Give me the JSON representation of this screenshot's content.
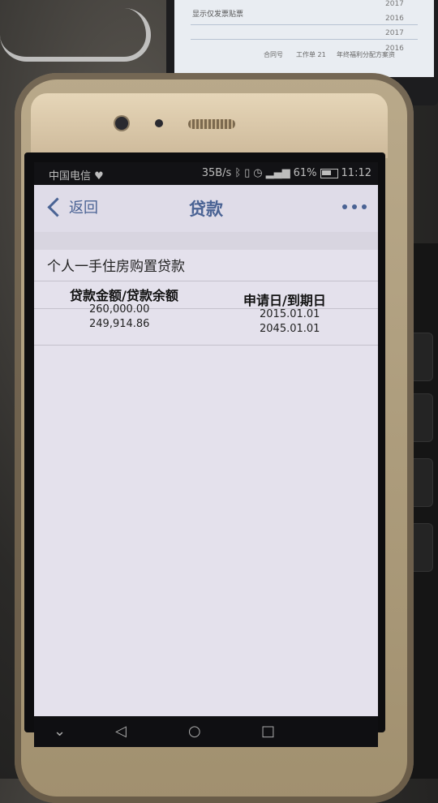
{
  "status": {
    "carrier": "中国电信",
    "net_speed": "35B/s",
    "battery": "61%",
    "time": "11:12"
  },
  "nav": {
    "back_label": "返回",
    "title": "贷款"
  },
  "loan": {
    "title": "个人一手住房购置贷款",
    "headers": {
      "amount": "贷款金额/贷款余额",
      "dates": "申请日/到期日"
    },
    "amount": "260,000.00",
    "balance": "249,914.86",
    "apply_date": "2015.01.01",
    "due_date": "2045.01.01"
  },
  "background_monitor": {
    "years": [
      "2017",
      "2016",
      "2017",
      "2016"
    ],
    "checkbox_label": "显示仅发票贴票",
    "footer_texts": [
      "合同号",
      "工作单 21",
      "年终福利分配方案资"
    ]
  },
  "keys": [
    "R",
    "F"
  ],
  "icons": {
    "back": "chevron-left-icon",
    "more": "more-dots-icon",
    "bluetooth": "bluetooth-icon",
    "alarm": "alarm-icon",
    "battery": "battery-icon",
    "heart": "heart-icon"
  },
  "colors": {
    "accent": "#4a6394",
    "screen_bg": "#e4e1ec"
  }
}
